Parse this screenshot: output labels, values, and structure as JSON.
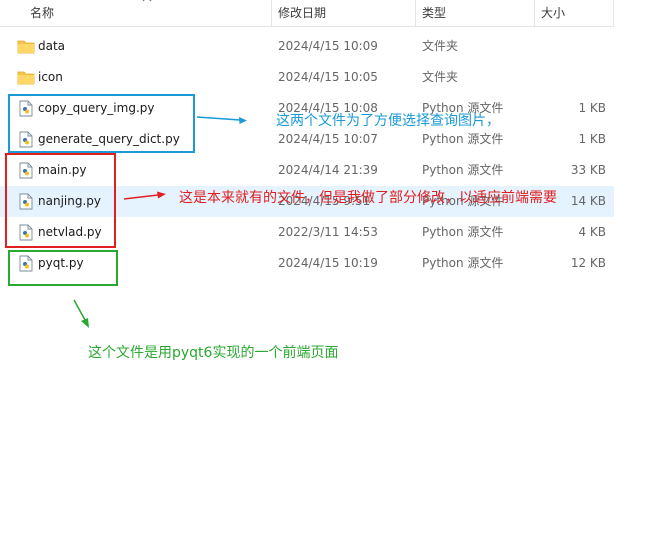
{
  "columns": {
    "name": "名称",
    "date": "修改日期",
    "type": "类型",
    "size": "大小"
  },
  "files": [
    {
      "name": "data",
      "date": "2024/4/15 10:09",
      "type": "文件夹",
      "size": "",
      "icon": "folder-icon"
    },
    {
      "name": "icon",
      "date": "2024/4/15 10:05",
      "type": "文件夹",
      "size": "",
      "icon": "folder-icon"
    },
    {
      "name": "copy_query_img.py",
      "date": "2024/4/15 10:08",
      "type": "Python 源文件",
      "size": "1 KB",
      "icon": "python-file-icon"
    },
    {
      "name": "generate_query_dict.py",
      "date": "2024/4/15 10:07",
      "type": "Python 源文件",
      "size": "1 KB",
      "icon": "python-file-icon"
    },
    {
      "name": "main.py",
      "date": "2024/4/14 21:39",
      "type": "Python 源文件",
      "size": "33 KB",
      "icon": "python-file-icon"
    },
    {
      "name": "nanjing.py",
      "date": "2024/4/15 9:51",
      "type": "Python 源文件",
      "size": "14 KB",
      "icon": "python-file-icon"
    },
    {
      "name": "netvlad.py",
      "date": "2022/3/11 14:53",
      "type": "Python 源文件",
      "size": "4 KB",
      "icon": "python-file-icon"
    },
    {
      "name": "pyqt.py",
      "date": "2024/4/15 10:19",
      "type": "Python 源文件",
      "size": "12 KB",
      "icon": "python-file-icon"
    }
  ],
  "annotations": {
    "blue": "这两个文件为了方便选择查询图片，",
    "red": "这是本来就有的文件，但是我做了部分修改，以适应前端需要",
    "green": "这个文件是用pyqt6实现的一个前端页面"
  },
  "colors": {
    "blue": "#1a9ad6",
    "red": "#e02020",
    "green": "#2aa830",
    "folder": "#f7c44c",
    "hover": "#e5f3ff"
  }
}
